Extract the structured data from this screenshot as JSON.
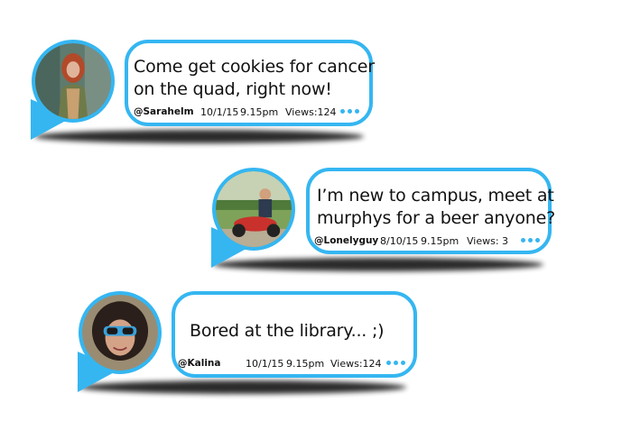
{
  "theme": {
    "accent": "#35b6f1",
    "shadow": "#1a1a1a"
  },
  "posts": [
    {
      "message_line1": "Come get cookies for cancer",
      "message_line2": "on the quad, right now!",
      "handle": "@Sarahelm",
      "date": "10/1/15",
      "time": "9.15pm",
      "views": "Views:124",
      "more_icon": "more-dots-icon"
    },
    {
      "message_line1": "I’m new to campus, meet at",
      "message_line2": "murphys for a beer anyone?",
      "handle": "@Lonelyguy",
      "date": "8/10/15",
      "time": "9.15pm",
      "views": "Views:  3",
      "more_icon": "more-dots-icon"
    },
    {
      "message_line1": "Bored at the library... ;)",
      "message_line2": "",
      "handle": "@Kalina",
      "date": "10/1/15",
      "time": "9.15pm",
      "views": "Views:124",
      "more_icon": "more-dots-icon"
    }
  ]
}
